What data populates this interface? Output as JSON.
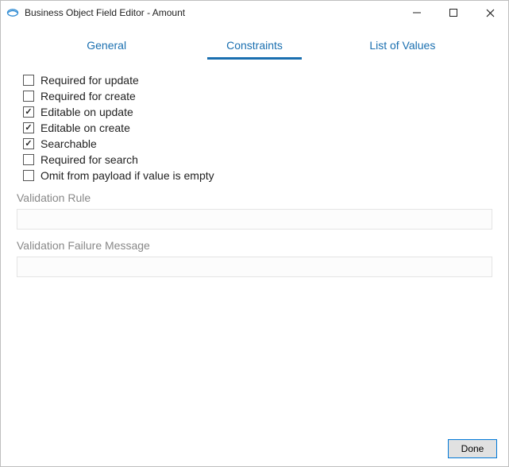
{
  "window": {
    "title": "Business Object Field Editor - Amount"
  },
  "tabs": {
    "general": "General",
    "constraints": "Constraints",
    "list_of_values": "List of Values",
    "active": "constraints"
  },
  "checks": [
    {
      "label": "Required for update",
      "checked": false
    },
    {
      "label": "Required for create",
      "checked": false
    },
    {
      "label": "Editable on update",
      "checked": true
    },
    {
      "label": "Editable on create",
      "checked": true
    },
    {
      "label": "Searchable",
      "checked": true
    },
    {
      "label": "Required for search",
      "checked": false
    },
    {
      "label": "Omit from payload if value is empty",
      "checked": false
    }
  ],
  "fields": {
    "validation_rule_label": "Validation Rule",
    "validation_rule_value": "",
    "validation_failure_label": "Validation Failure Message",
    "validation_failure_value": ""
  },
  "footer": {
    "done_label": "Done"
  }
}
